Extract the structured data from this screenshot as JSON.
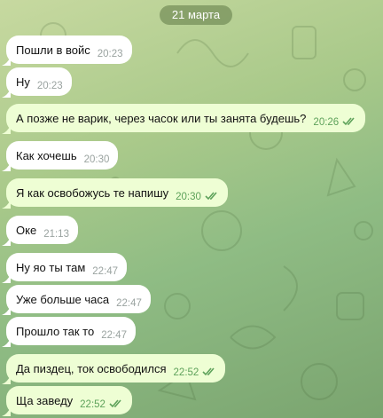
{
  "chat": {
    "date": "21 марта",
    "messages": [
      {
        "text": "Пошли в войс",
        "time": "20:23",
        "direction": "in"
      },
      {
        "text": "Ну",
        "time": "20:23",
        "direction": "in"
      },
      {
        "text": "А позже не варик, через часок или ты занята будешь?",
        "time": "20:26",
        "direction": "out",
        "status": "read"
      },
      {
        "text": "Как хочешь",
        "time": "20:30",
        "direction": "in"
      },
      {
        "text": "Я как освобожусь те напишу",
        "time": "20:30",
        "direction": "out",
        "status": "read"
      },
      {
        "text": "Оке",
        "time": "21:13",
        "direction": "in"
      },
      {
        "text": "Ну яо ты там",
        "time": "22:47",
        "direction": "in"
      },
      {
        "text": "Уже больше часа",
        "time": "22:47",
        "direction": "in"
      },
      {
        "text": "Прошло так то",
        "time": "22:47",
        "direction": "in"
      },
      {
        "text": "Да пиздец, ток освободился",
        "time": "22:52",
        "direction": "out",
        "status": "read"
      },
      {
        "text": "Ща заведу",
        "time": "22:52",
        "direction": "out",
        "status": "read"
      }
    ]
  },
  "colors": {
    "incoming_bubble": "#ffffff",
    "outgoing_bubble": "#eefed4",
    "read_ticks": "#5ea25b"
  },
  "icons": {
    "read_status": "double-check-icon"
  }
}
